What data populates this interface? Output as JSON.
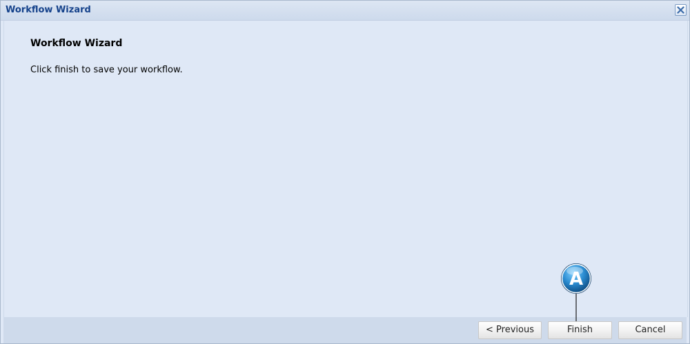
{
  "dialog": {
    "title": "Workflow Wizard",
    "close_icon": "close-icon"
  },
  "content": {
    "heading": "Workflow Wizard",
    "message": "Click finish to save your workflow."
  },
  "footer": {
    "previous_label": "< Previous",
    "finish_label": "Finish",
    "cancel_label": "Cancel"
  },
  "annotation": {
    "marker_label": "A"
  },
  "colors": {
    "title_text": "#15428b",
    "panel_bg": "#dfe8f6",
    "footer_bg": "#cedaeb",
    "marker_blue": "#1f7fc4"
  }
}
